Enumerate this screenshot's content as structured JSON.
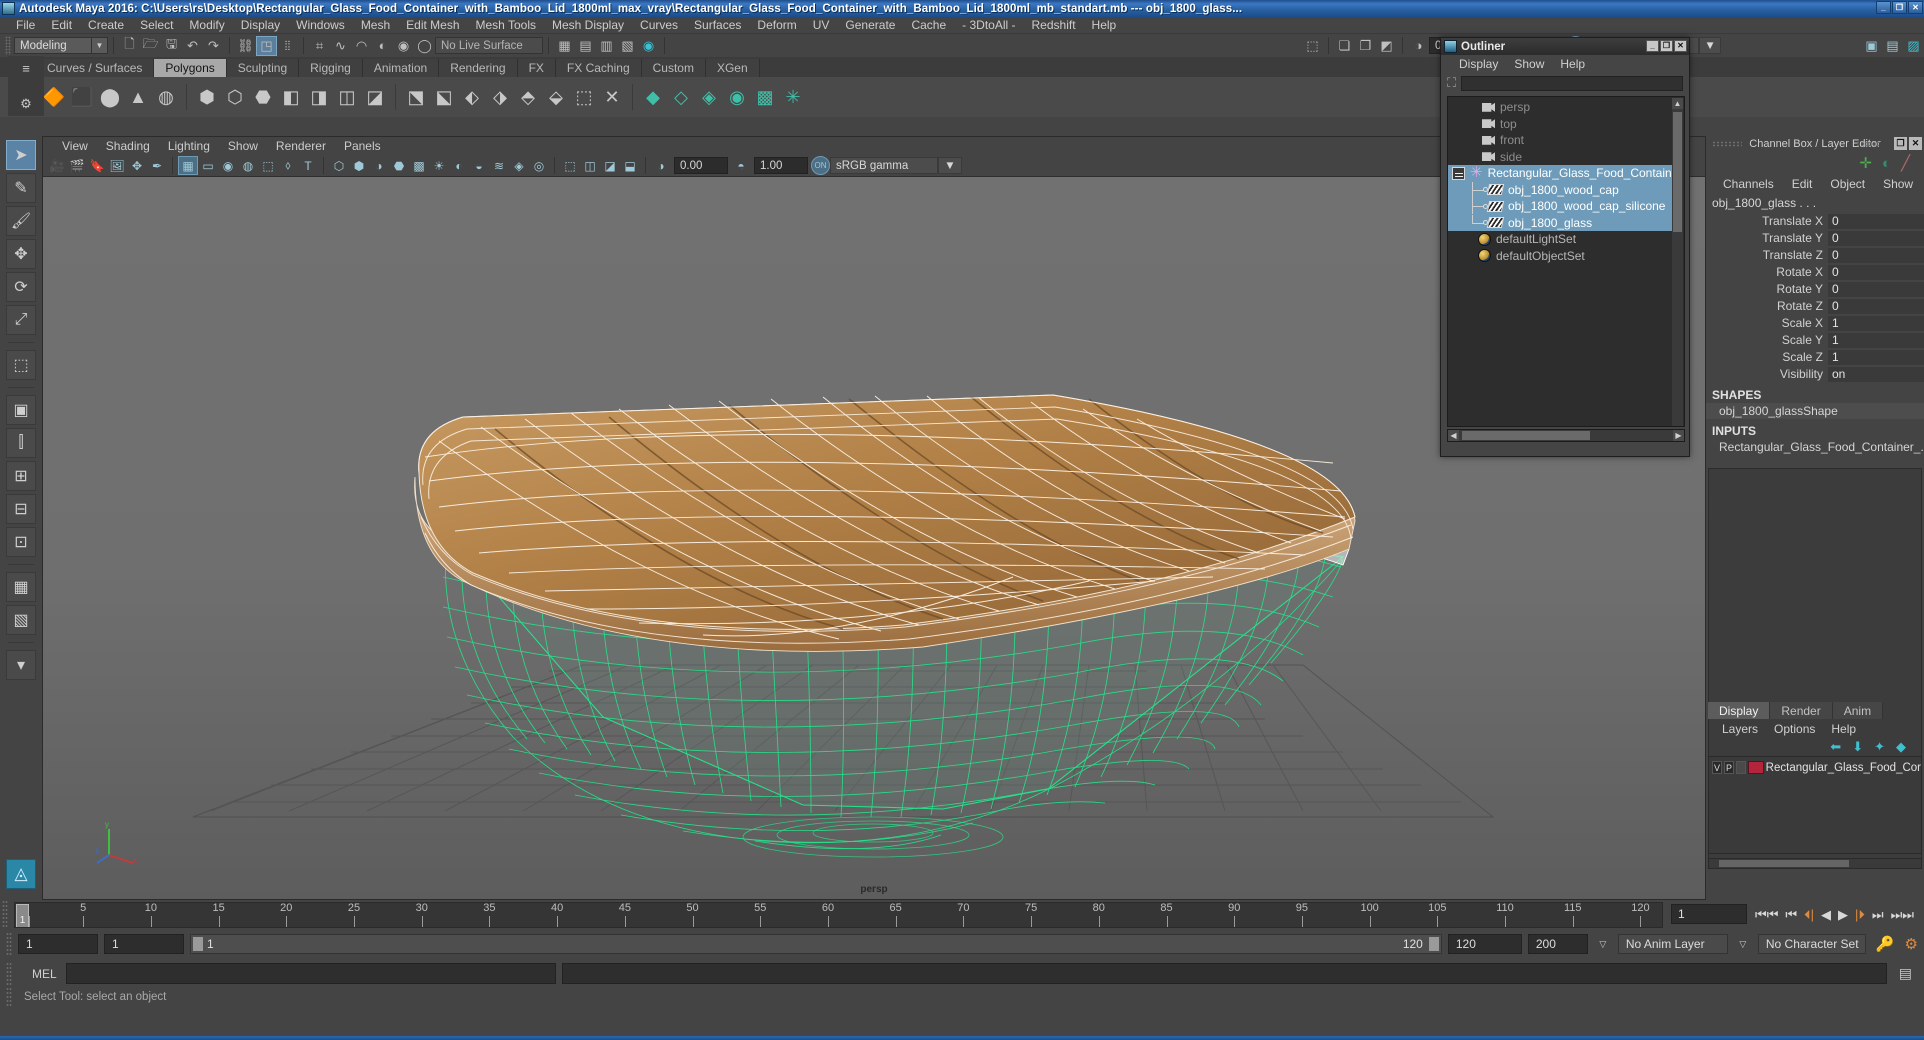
{
  "titlebar": {
    "text": "Autodesk Maya 2016: C:\\Users\\rs\\Desktop\\Rectangular_Glass_Food_Container_with_Bamboo_Lid_1800ml_max_vray\\Rectangular_Glass_Food_Container_with_Bamboo_Lid_1800ml_mb_standart.mb  ---  obj_1800_glass...",
    "minimize": "_",
    "maximize": "❐",
    "close": "✕"
  },
  "menubar": {
    "items": [
      "File",
      "Edit",
      "Create",
      "Select",
      "Modify",
      "Display",
      "Windows",
      "Mesh",
      "Edit Mesh",
      "Mesh Tools",
      "Mesh Display",
      "Curves",
      "Surfaces",
      "Deform",
      "UV",
      "Generate",
      "Cache",
      "- 3DtoAll -",
      "Redshift",
      "Help"
    ]
  },
  "statusline": {
    "mode": "Modeling",
    "live_surface": "No Live Surface",
    "gamma_value": "0.00",
    "exposure_value": "1.00",
    "color_management": "sRGB gamma",
    "toggle_on_label": "ON"
  },
  "shelf": {
    "tabs": [
      "Curves / Surfaces",
      "Polygons",
      "Sculpting",
      "Rigging",
      "Animation",
      "Rendering",
      "FX",
      "FX Caching",
      "Custom",
      "XGen"
    ],
    "active_tab": "Polygons"
  },
  "viewport": {
    "menu": [
      "View",
      "Shading",
      "Lighting",
      "Show",
      "Renderer",
      "Panels"
    ],
    "camera_label": "persp",
    "axis": {
      "x": "x",
      "y": "y",
      "z": "z"
    }
  },
  "outliner": {
    "title": "Outliner",
    "minimize": "_",
    "maximize": "❐",
    "close": "✕",
    "menu": [
      "Display",
      "Show",
      "Help"
    ],
    "search_value": "",
    "rows": [
      {
        "label": "persp",
        "icon": "camera-icon",
        "indent": 1,
        "state": "dim"
      },
      {
        "label": "top",
        "icon": "camera-icon",
        "indent": 1,
        "state": "dim"
      },
      {
        "label": "front",
        "icon": "camera-icon",
        "indent": 1,
        "state": "dim"
      },
      {
        "label": "side",
        "icon": "camera-icon",
        "indent": 1,
        "state": "dim"
      },
      {
        "label": "Rectangular_Glass_Food_Contain",
        "icon": "group-star-icon",
        "indent": 0,
        "state": "selected"
      },
      {
        "label": "obj_1800_wood_cap",
        "icon": "mesh-icon",
        "indent": 2,
        "state": "selected"
      },
      {
        "label": "obj_1800_wood_cap_silicone",
        "icon": "mesh-icon",
        "indent": 2,
        "state": "selected"
      },
      {
        "label": "obj_1800_glass",
        "icon": "mesh-icon",
        "indent": 2,
        "state": "selected"
      },
      {
        "label": "defaultLightSet",
        "icon": "set-icon",
        "indent": 1,
        "state": "normal"
      },
      {
        "label": "defaultObjectSet",
        "icon": "set-icon",
        "indent": 1,
        "state": "normal"
      }
    ]
  },
  "channelbox": {
    "title": "Channel Box / Layer Editor",
    "restore": "❐",
    "close": "✕",
    "menu": [
      "Channels",
      "Edit",
      "Object",
      "Show"
    ],
    "object_name": "obj_1800_glass . . .",
    "channels": [
      {
        "label": "Translate X",
        "value": "0"
      },
      {
        "label": "Translate Y",
        "value": "0"
      },
      {
        "label": "Translate Z",
        "value": "0"
      },
      {
        "label": "Rotate X",
        "value": "0"
      },
      {
        "label": "Rotate Y",
        "value": "0"
      },
      {
        "label": "Rotate Z",
        "value": "0"
      },
      {
        "label": "Scale X",
        "value": "1"
      },
      {
        "label": "Scale Y",
        "value": "1"
      },
      {
        "label": "Scale Z",
        "value": "1"
      },
      {
        "label": "Visibility",
        "value": "on"
      }
    ],
    "shapes_header": "SHAPES",
    "shapes_item": "obj_1800_glassShape",
    "inputs_header": "INPUTS",
    "inputs_item": "Rectangular_Glass_Food_Container_..."
  },
  "layereditor": {
    "tabs": [
      "Display",
      "Render",
      "Anim"
    ],
    "active_tab": "Display",
    "menu": [
      "Layers",
      "Options",
      "Help"
    ],
    "layers": [
      {
        "visible": "V",
        "playback": "P",
        "color": "#b4243a",
        "name": "Rectangular_Glass_Food_Cor"
      }
    ]
  },
  "timeline": {
    "ticks": [
      {
        "value": "1",
        "frame": 1
      },
      {
        "value": "5",
        "frame": 5
      },
      {
        "value": "10",
        "frame": 10
      },
      {
        "value": "15",
        "frame": 15
      },
      {
        "value": "20",
        "frame": 20
      },
      {
        "value": "25",
        "frame": 25
      },
      {
        "value": "30",
        "frame": 30
      },
      {
        "value": "35",
        "frame": 35
      },
      {
        "value": "40",
        "frame": 40
      },
      {
        "value": "45",
        "frame": 45
      },
      {
        "value": "50",
        "frame": 50
      },
      {
        "value": "55",
        "frame": 55
      },
      {
        "value": "60",
        "frame": 60
      },
      {
        "value": "65",
        "frame": 65
      },
      {
        "value": "70",
        "frame": 70
      },
      {
        "value": "75",
        "frame": 75
      },
      {
        "value": "80",
        "frame": 80
      },
      {
        "value": "85",
        "frame": 85
      },
      {
        "value": "90",
        "frame": 90
      },
      {
        "value": "95",
        "frame": 95
      },
      {
        "value": "100",
        "frame": 100
      },
      {
        "value": "105",
        "frame": 105
      },
      {
        "value": "110",
        "frame": 110
      },
      {
        "value": "115",
        "frame": 115
      },
      {
        "value": "120",
        "frame": 120
      }
    ],
    "current_frame": "1",
    "cursor_label": "1",
    "range_start": "1",
    "range_end_field": "1",
    "range_bar_start": "1",
    "range_bar_end": "120",
    "anim_end": "120",
    "playback_end": "200",
    "anim_layer": "No Anim Layer",
    "character_set": "No Character Set"
  },
  "commandline": {
    "language": "MEL",
    "input_value": "",
    "output_value": ""
  },
  "statusbar": {
    "text": "Select Tool: select an object"
  },
  "colors": {
    "accent_blue": "#5b83a6",
    "selection_blue": "#6d9bb9",
    "wireframe_green": "#27e08a",
    "wood": "#b5824a",
    "layer_red": "#b4243a",
    "panel_bg": "#444444"
  }
}
